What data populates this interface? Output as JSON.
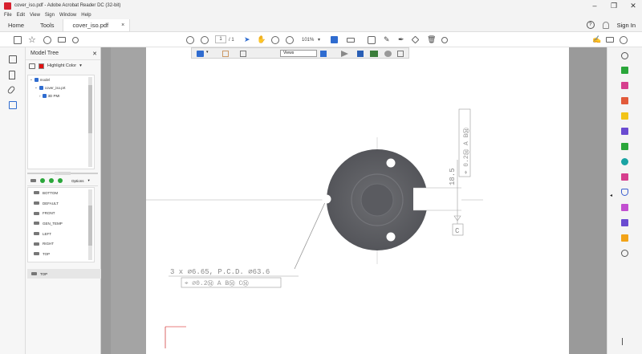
{
  "window": {
    "title": "cover_iso.pdf - Adobe Acrobat Reader DC (32-bit)",
    "minimize": "–",
    "restore": "❐",
    "close": "✕"
  },
  "menu": [
    "File",
    "Edit",
    "View",
    "Sign",
    "Window",
    "Help"
  ],
  "tabs": {
    "home": "Home",
    "tools": "Tools",
    "document": "cover_iso.pdf",
    "doc_close": "×",
    "help_glyph": "?",
    "sign_in": "Sign In"
  },
  "toolbar": {
    "page_current": "1",
    "page_total": "/ 1",
    "zoom": "101%"
  },
  "model_tree": {
    "title": "Model Tree",
    "close": "✕",
    "highlight_color_label": "Highlight Color",
    "highlight_color": "#e01010",
    "nodes": [
      "model",
      "cover_iso.prt",
      "3D PMI"
    ],
    "options_label": "Options",
    "views": [
      "BOTTOM",
      "DEFAULT",
      "FRONT",
      "GEN_TEMP",
      "LEFT",
      "RIGHT",
      "TOP"
    ],
    "selected_view": "TOP"
  },
  "toolbar3d": {
    "views_select": "Views"
  },
  "drawing": {
    "hole_callout": "3 x ⌀6.65, P.C.D. ⌀63.6",
    "hole_fcf": "⌖ ⌀0.2Ⓜ A BⓂ CⓂ",
    "dim_value": "18.5",
    "slot_fcf": "⌖ 0.2Ⓜ A BⓂ",
    "datum_c": "C"
  },
  "colors": {
    "accent": "#2f6cd0",
    "brand_red": "#d7212f",
    "part_gray": "#5e5e62"
  },
  "icons": {
    "left_rail": [
      "page-thumbnails-icon",
      "bookmark-icon",
      "attachment-icon",
      "model-tree-icon"
    ],
    "right_rail": [
      "zoom-icon",
      "export-pdf-icon",
      "edit-pdf-icon",
      "create-pdf-icon",
      "comment-icon",
      "combine-files-icon",
      "organize-pages-icon",
      "compress-icon",
      "fill-sign-icon",
      "protect-icon",
      "send-icon",
      "sign-icon",
      "stamp-icon",
      "more-tools-icon"
    ]
  }
}
